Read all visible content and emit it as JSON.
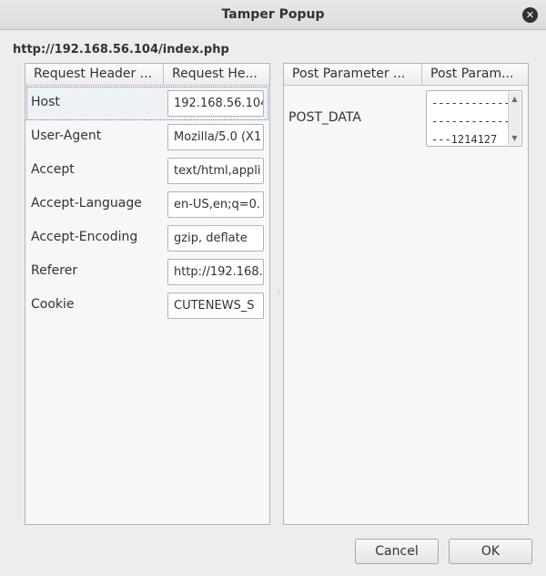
{
  "window": {
    "title": "Tamper Popup",
    "close_icon": "close-icon"
  },
  "url": "http://192.168.56.104/index.php",
  "headers_table": {
    "columns": [
      "Request Header ...",
      "Request He..."
    ],
    "rows": [
      {
        "name": "Host",
        "value": "192.168.56.104"
      },
      {
        "name": "User-Agent",
        "value": "Mozilla/5.0 (X1"
      },
      {
        "name": "Accept",
        "value": "text/html,appli"
      },
      {
        "name": "Accept-Language",
        "value": "en-US,en;q=0."
      },
      {
        "name": "Accept-Encoding",
        "value": "gzip, deflate"
      },
      {
        "name": "Referer",
        "value": "http://192.168."
      },
      {
        "name": "Cookie",
        "value": "CUTENEWS_S"
      }
    ]
  },
  "post_table": {
    "columns": [
      "Post Parameter ...",
      "Post Param..."
    ],
    "rows": [
      {
        "name": "POST_DATA",
        "value": "-------------\n-------------\n---1214127"
      }
    ]
  },
  "buttons": {
    "cancel": "Cancel",
    "ok": "OK"
  },
  "colors": {
    "background": "#ededed",
    "panel": "#f7f7f7",
    "selection_outline": "#5a7fb0"
  }
}
